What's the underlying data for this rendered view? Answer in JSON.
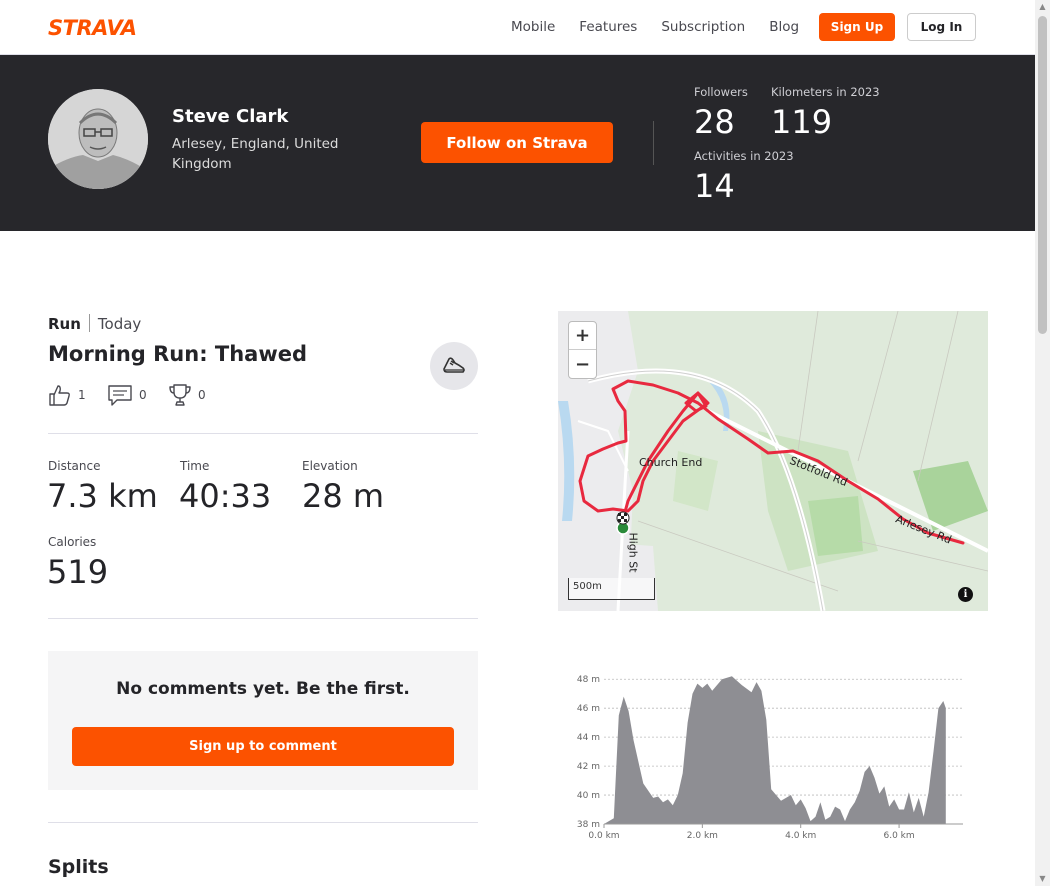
{
  "nav": {
    "logo": "STRAVA",
    "links": [
      "Mobile",
      "Features",
      "Subscription",
      "Blog"
    ],
    "signup": "Sign Up",
    "login": "Log In"
  },
  "athlete": {
    "name": "Steve Clark",
    "location": "Arlesey, England, United Kingdom",
    "follow": "Follow on Strava",
    "stats": {
      "followers_label": "Followers",
      "followers": "28",
      "km_label": "Kilometers in 2023",
      "km": "119",
      "activities_label": "Activities in 2023",
      "activities": "14"
    }
  },
  "activity": {
    "type": "Run",
    "when": "Today",
    "title": "Morning Run: Thawed",
    "kudos": "1",
    "comments": "0",
    "achievements": "0",
    "metrics": {
      "distance_label": "Distance",
      "distance": "7.3 km",
      "time_label": "Time",
      "time": "40:33",
      "elevation_label": "Elevation",
      "elevation": "28 m",
      "calories_label": "Calories",
      "calories": "519"
    },
    "no_comments": "No comments yet. Be the first.",
    "comment_button": "Sign up to comment",
    "splits_heading": "Splits"
  },
  "map": {
    "zoom_in": "+",
    "zoom_out": "−",
    "scale": "500m",
    "info": "i",
    "labels": {
      "church_end": "Church End",
      "stotfold_rd": "Stotfold Rd",
      "arlesey_rd": "Arlesey Rd",
      "high_st": "High St"
    },
    "colors": {
      "route": "#e8293f",
      "land": "#dfeadb"
    }
  },
  "chart_data": {
    "type": "area",
    "xlabel": "",
    "ylabel": "",
    "xlim": [
      0,
      7.3
    ],
    "ylim": [
      38,
      48.5
    ],
    "x_ticks": [
      "0.0 km",
      "2.0 km",
      "4.0 km",
      "6.0 km"
    ],
    "y_ticks": [
      "38 m",
      "40 m",
      "42 m",
      "44 m",
      "46 m",
      "48 m"
    ],
    "x": [
      0.0,
      0.2,
      0.3,
      0.4,
      0.5,
      0.6,
      0.8,
      1.0,
      1.1,
      1.2,
      1.3,
      1.4,
      1.5,
      1.6,
      1.7,
      1.8,
      1.9,
      2.0,
      2.1,
      2.2,
      2.4,
      2.6,
      2.8,
      3.0,
      3.1,
      3.2,
      3.3,
      3.4,
      3.6,
      3.8,
      3.9,
      4.0,
      4.1,
      4.2,
      4.3,
      4.4,
      4.5,
      4.6,
      4.7,
      4.8,
      4.9,
      5.0,
      5.1,
      5.2,
      5.3,
      5.4,
      5.5,
      5.6,
      5.7,
      5.8,
      5.9,
      6.0,
      6.1,
      6.2,
      6.3,
      6.4,
      6.5,
      6.6,
      6.7,
      6.8,
      6.9,
      6.95
    ],
    "values": [
      38.0,
      38.4,
      45.5,
      46.8,
      45.8,
      43.8,
      40.8,
      39.8,
      39.9,
      39.5,
      39.7,
      39.3,
      40.0,
      41.5,
      45.0,
      47.0,
      47.7,
      47.4,
      47.7,
      47.2,
      48.0,
      48.2,
      47.6,
      47.1,
      47.8,
      47.2,
      45.2,
      40.4,
      39.6,
      40.0,
      39.3,
      39.7,
      39.1,
      38.2,
      38.5,
      39.5,
      38.3,
      38.5,
      39.2,
      39.0,
      38.2,
      39.0,
      39.5,
      40.3,
      41.6,
      42.0,
      41.2,
      40.1,
      40.6,
      39.2,
      39.7,
      39.0,
      39.0,
      40.2,
      38.8,
      39.8,
      38.5,
      40.2,
      43.0,
      46.0,
      46.5,
      46.0
    ],
    "colors": {
      "fill": "#8e8e93",
      "grid": "#bbbbbb"
    }
  }
}
